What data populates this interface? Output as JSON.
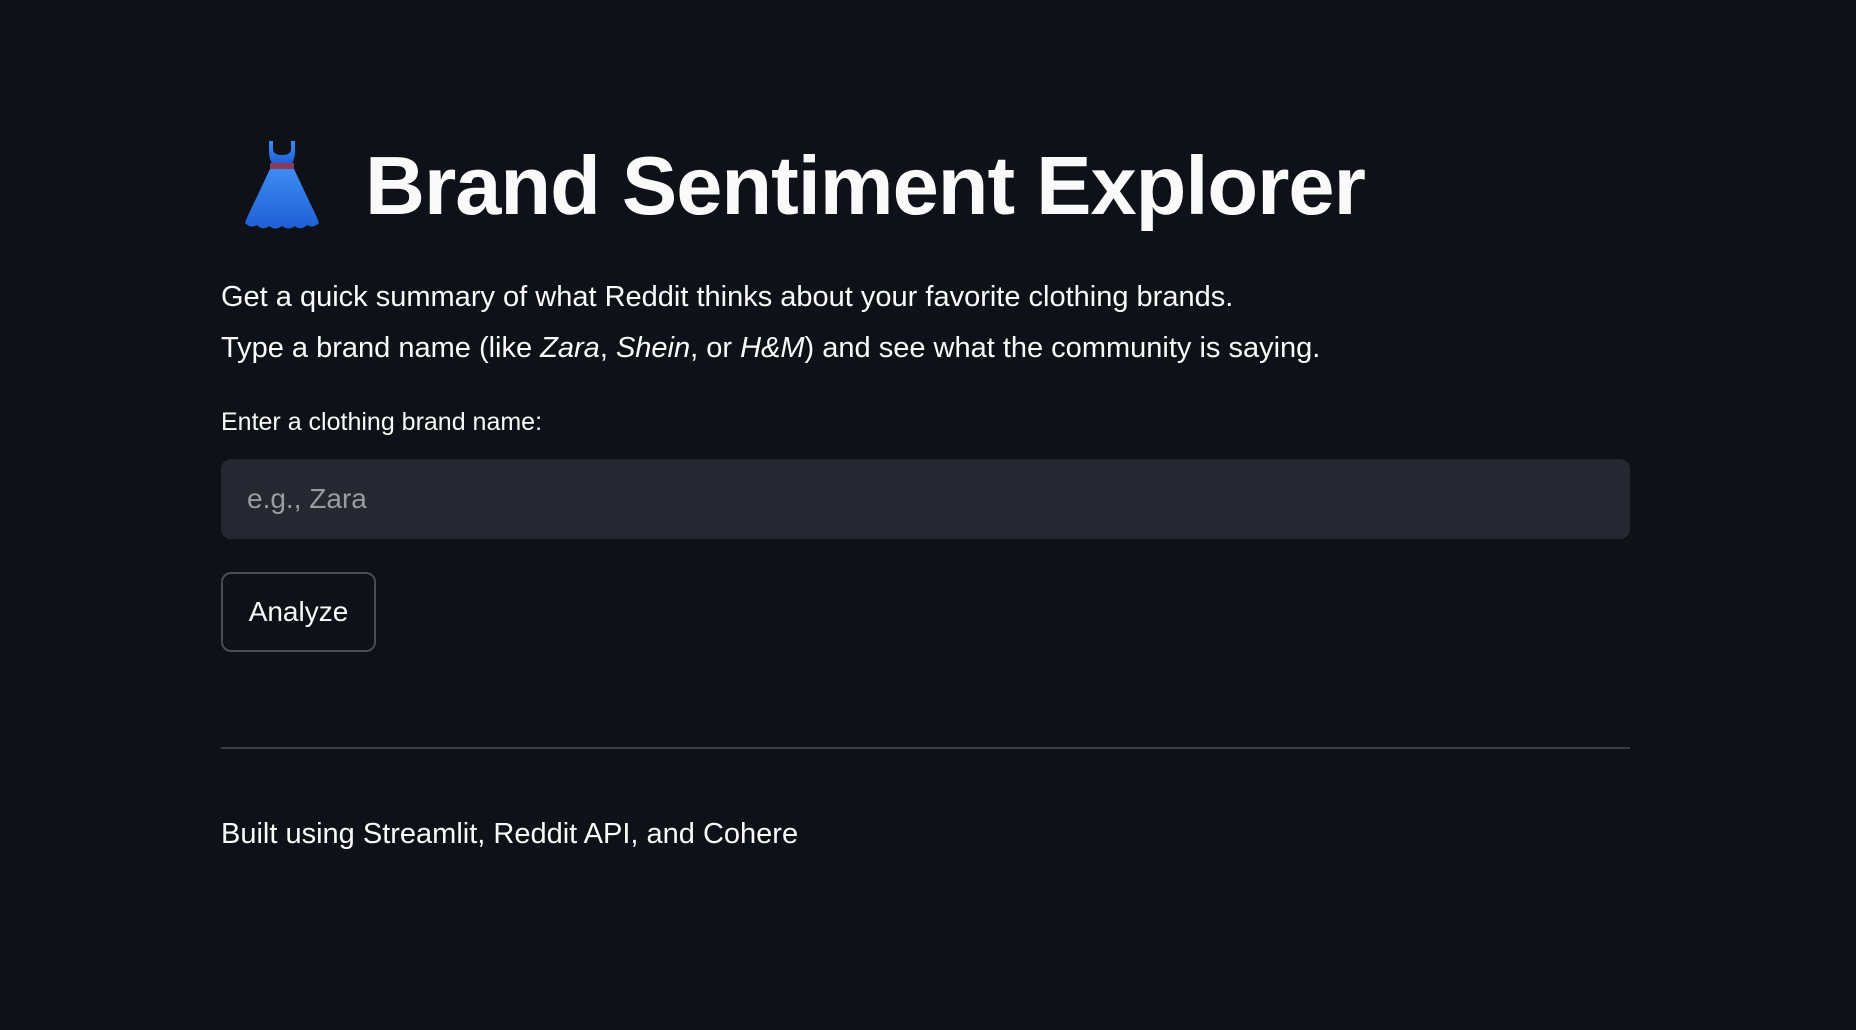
{
  "header": {
    "icon": "dress-icon",
    "title": "Brand Sentiment Explorer"
  },
  "intro": {
    "line1": "Get a quick summary of what Reddit thinks about your favorite clothing brands.",
    "line2_prefix": "Type a brand name (like ",
    "example1": "Zara",
    "sep1": ", ",
    "example2": "Shein",
    "sep2": ", or ",
    "example3": "H&M",
    "line2_suffix": ") and see what the community is saying."
  },
  "search": {
    "label": "Enter a clothing brand name:",
    "placeholder": "e.g., Zara",
    "value": ""
  },
  "actions": {
    "analyze_label": "Analyze"
  },
  "footer": {
    "text": "Built using Streamlit, Reddit API, and Cohere"
  },
  "colors": {
    "background": "#0e1117",
    "input_background": "#262730",
    "text": "#fafafa",
    "icon_blue": "#2f6fe6"
  }
}
